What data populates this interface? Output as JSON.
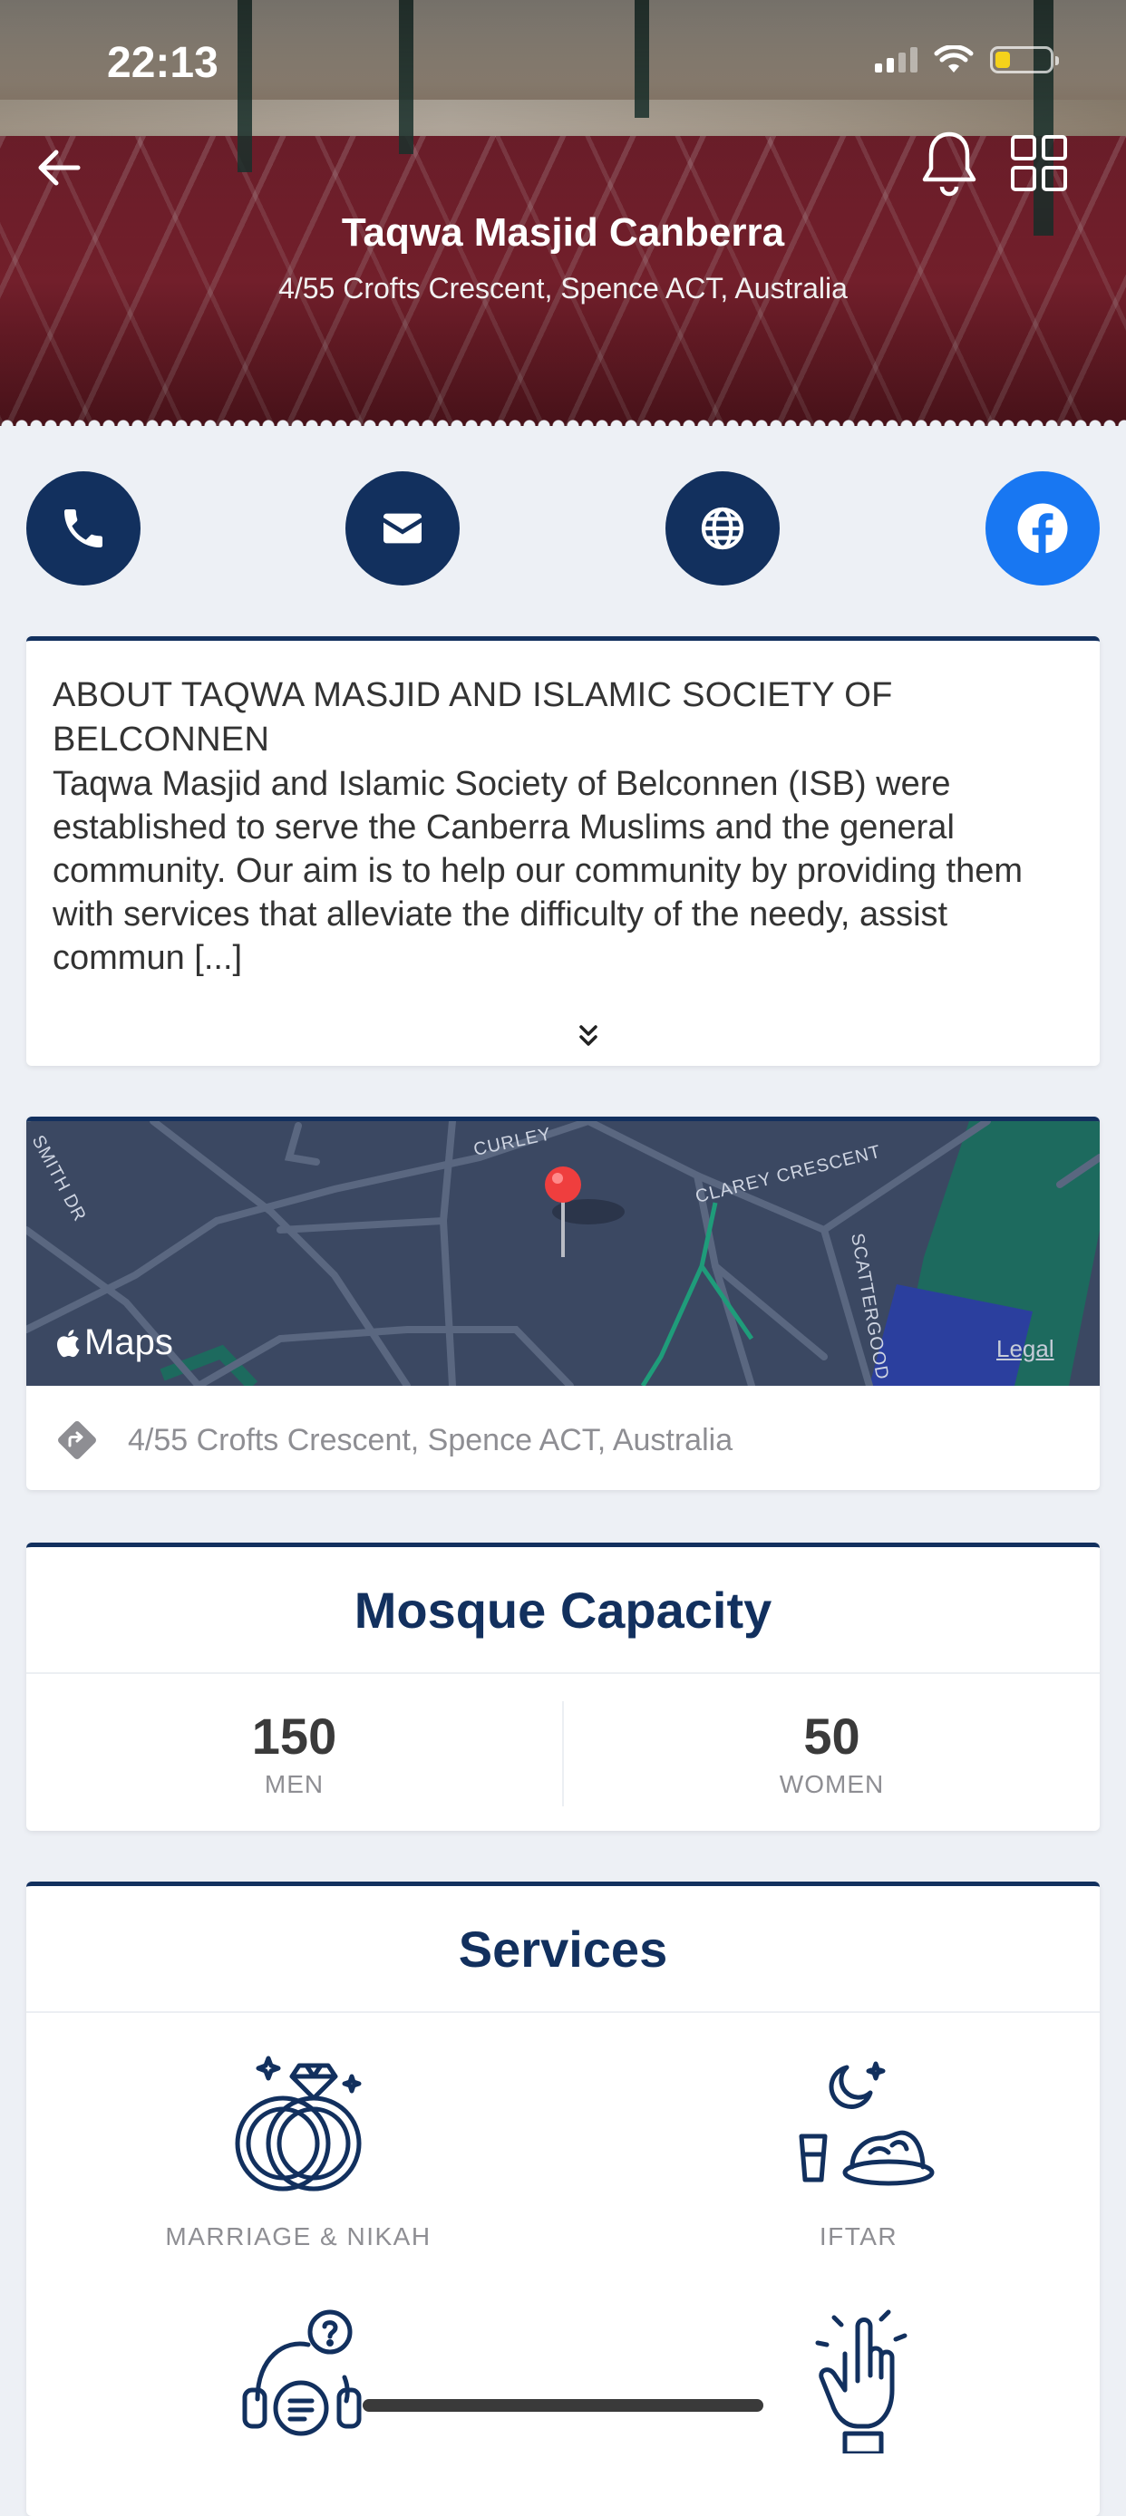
{
  "status_bar": {
    "time": "22:13"
  },
  "header": {
    "title": "Taqwa Masjid Canberra",
    "address": "4/55 Crofts Crescent, Spence ACT, Australia"
  },
  "contact_buttons": [
    {
      "icon": "phone-icon"
    },
    {
      "icon": "mail-icon"
    },
    {
      "icon": "globe-icon"
    },
    {
      "icon": "facebook-icon",
      "color": "#1877f2"
    }
  ],
  "about": {
    "heading": "ABOUT TAQWA MASJID AND ISLAMIC SOCIETY OF BELCONNEN",
    "text": "Taqwa Masjid and Islamic Society of Belconnen (ISB) were established to serve the Canberra Muslims and the general community. Our aim is to help our community by providing them with services that alleviate the difficulty of the needy, assist commun [...]"
  },
  "map": {
    "logo_text": "Maps",
    "legal_text": "Legal",
    "street_labels": [
      "CURLEY",
      "CLAREY CRESCENT",
      "SMITH DR",
      "SCATTERGOOD"
    ],
    "address": "4/55 Crofts Crescent, Spence ACT, Australia"
  },
  "capacity": {
    "title": "Mosque Capacity",
    "men": {
      "value": "150",
      "label": "MEN"
    },
    "women": {
      "value": "50",
      "label": "WOMEN"
    }
  },
  "services": {
    "title": "Services",
    "items": [
      {
        "label": "MARRIAGE & NIKAH",
        "icon": "rings-icon"
      },
      {
        "label": "IFTAR",
        "icon": "iftar-icon"
      },
      {
        "label": "",
        "icon": "counseling-icon"
      },
      {
        "label": "",
        "icon": "raised-hand-icon"
      }
    ]
  },
  "colors": {
    "primary": "#12305e",
    "facebook": "#1877f2",
    "background": "#edf0f5"
  }
}
